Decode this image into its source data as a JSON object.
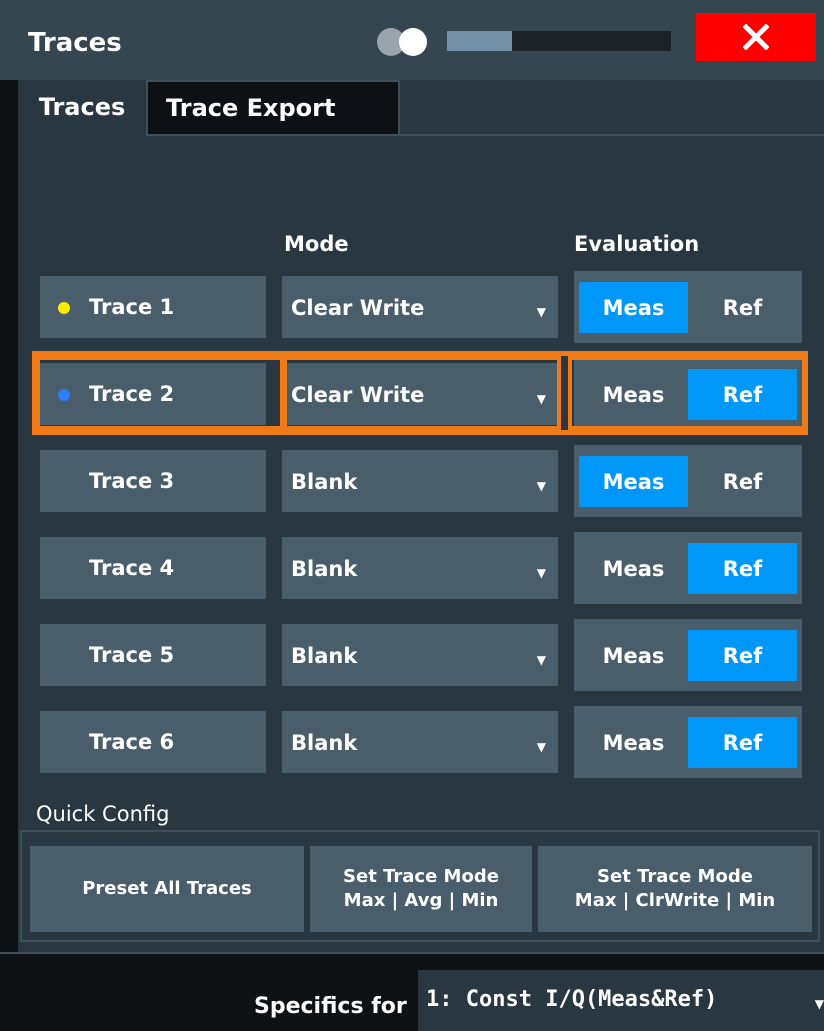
{
  "window": {
    "title": "Traces",
    "slider_fill": 0.29
  },
  "tabs": [
    {
      "label": "Traces",
      "active": true
    },
    {
      "label": "Trace Export",
      "active": false
    }
  ],
  "headers": {
    "mode": "Mode",
    "evaluation": "Evaluation"
  },
  "traces": [
    {
      "label": "Trace 1",
      "dot_color": "#ffeb00",
      "mode": "Clear Write",
      "meas": "Meas",
      "ref": "Ref",
      "selected_eval": "meas"
    },
    {
      "label": "Trace 2",
      "dot_color": "#2f7dff",
      "mode": "Clear Write",
      "meas": "Meas",
      "ref": "Ref",
      "selected_eval": "ref",
      "highlighted": true
    },
    {
      "label": "Trace 3",
      "mode": "Blank",
      "meas": "Meas",
      "ref": "Ref",
      "selected_eval": "meas"
    },
    {
      "label": "Trace 4",
      "mode": "Blank",
      "meas": "Meas",
      "ref": "Ref",
      "selected_eval": "ref"
    },
    {
      "label": "Trace 5",
      "mode": "Blank",
      "meas": "Meas",
      "ref": "Ref",
      "selected_eval": "ref"
    },
    {
      "label": "Trace 6",
      "mode": "Blank",
      "meas": "Meas",
      "ref": "Ref",
      "selected_eval": "ref"
    }
  ],
  "quick_config": {
    "label": "Quick Config",
    "preset": "Preset All Traces",
    "mode1_line1": "Set Trace Mode",
    "mode1_line2": "Max | Avg | Min",
    "mode2_line1": "Set Trace Mode",
    "mode2_line2": "Max | ClrWrite | Min"
  },
  "specifics": {
    "label": "Specifics for",
    "value": "1: Const I/Q(Meas&Ref)"
  },
  "colors": {
    "accent": "#0098f8",
    "highlight": "#f07a16",
    "close": "#ff0000",
    "panel": "#283740",
    "button": "#495d6a"
  }
}
